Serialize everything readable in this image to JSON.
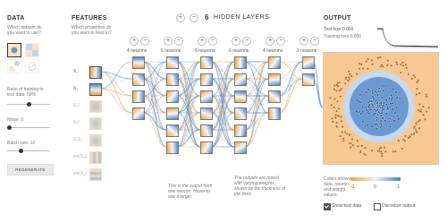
{
  "data_panel": {
    "title": "DATA",
    "question": "Which dataset do you want to use?",
    "ratio_label": "Ratio of training to test data: 50%",
    "ratio_value": 0.5,
    "noise_label": "Noise: 0",
    "noise_value": 0,
    "batch_label": "Batch size: 10",
    "batch_value": 0.3,
    "regenerate": "REGENERATE"
  },
  "features": {
    "title": "FEATURES",
    "question": "Which properties do you want to feed in?",
    "items": [
      {
        "label": "X₁",
        "active": true
      },
      {
        "label": "X₂",
        "active": true
      },
      {
        "label": "X₁²",
        "active": false
      },
      {
        "label": "X₂²",
        "active": false
      },
      {
        "label": "X₁X₂",
        "active": false
      },
      {
        "label": "sin(X₁)",
        "active": false
      },
      {
        "label": "sin(X₂)",
        "active": false
      }
    ]
  },
  "hidden": {
    "count": "6",
    "label": "HIDDEN LAYERS",
    "add": "+",
    "remove": "−",
    "layers": [
      {
        "label": "4 neurons",
        "count": 4
      },
      {
        "label": "6 neurons",
        "count": 6
      },
      {
        "label": "6 neurons",
        "count": 6
      },
      {
        "label": "6 neurons",
        "count": 6
      },
      {
        "label": "4 neurons",
        "count": 4
      },
      {
        "label": "2 neurons",
        "count": 2
      }
    ],
    "note_left": "This is the output from one neuron. Hover to see it larger.",
    "note_right": "The outputs are mixed with varying weights, shown by the thickness of the lines."
  },
  "output": {
    "title": "OUTPUT",
    "test_loss": "Test loss 0.000",
    "training_loss": "Training loss 0.000",
    "scale_left": "-1",
    "scale_mid": "0",
    "scale_right": "1",
    "color_note": "Colors shows data, neuron and weight values.",
    "show_test": "Show test data",
    "discretize": "Discretize output"
  },
  "colors": {
    "blue": "#4d84c4",
    "orange": "#f2a547",
    "neutral": "#e8eaee"
  }
}
